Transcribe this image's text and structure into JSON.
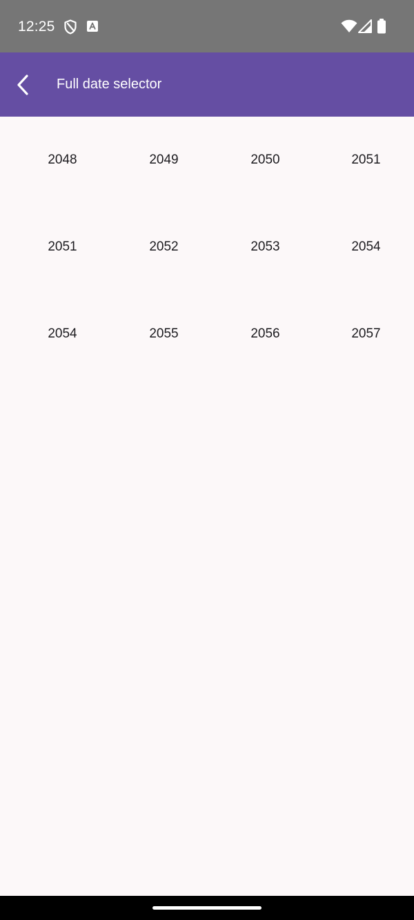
{
  "status_bar": {
    "time": "12:25",
    "left_icons": [
      "shield-icon",
      "font-a-icon"
    ],
    "right_icons": [
      "wifi-icon",
      "cell-signal-icon",
      "battery-icon"
    ]
  },
  "app_bar": {
    "back_icon": "chevron-left-icon",
    "title": "Full date selector"
  },
  "year_grid": {
    "rows": [
      [
        "2048",
        "2049",
        "2050",
        "2051"
      ],
      [
        "2051",
        "2052",
        "2053",
        "2054"
      ],
      [
        "2054",
        "2055",
        "2056",
        "2057"
      ]
    ]
  },
  "colors": {
    "status_bar_bg": "#767676",
    "app_bar_bg": "#654EA3",
    "background": "#FCF8F9",
    "text": "#1C1B1F"
  }
}
